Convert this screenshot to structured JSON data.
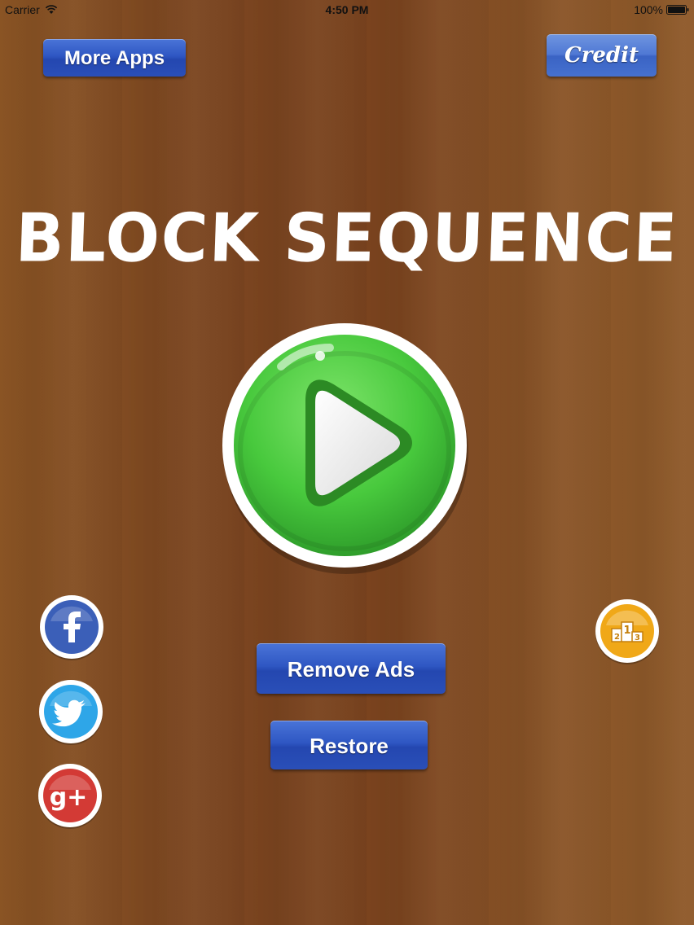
{
  "status_bar": {
    "carrier": "Carrier",
    "time": "4:50 PM",
    "battery": "100%"
  },
  "buttons": {
    "more_apps": "More Apps",
    "credit": "Credit",
    "remove_ads": "Remove Ads",
    "restore": "Restore"
  },
  "title": "BLOCK SEQUENCE",
  "icons": {
    "play": "play-icon",
    "facebook": "facebook-icon",
    "twitter": "twitter-icon",
    "google_plus": "google-plus-icon",
    "leaderboard": "leaderboard-icon"
  },
  "leaderboard_podium": [
    "2",
    "1",
    "3"
  ],
  "google_plus_label": "g+",
  "colors": {
    "background": "#7b4520",
    "button_blue": "#2f57c3",
    "play_green": "#3fc43d",
    "facebook_blue": "#3b5fb8",
    "twitter_blue": "#2ea6e8",
    "google_red": "#d33a35",
    "leaderboard_orange": "#f0a818"
  }
}
